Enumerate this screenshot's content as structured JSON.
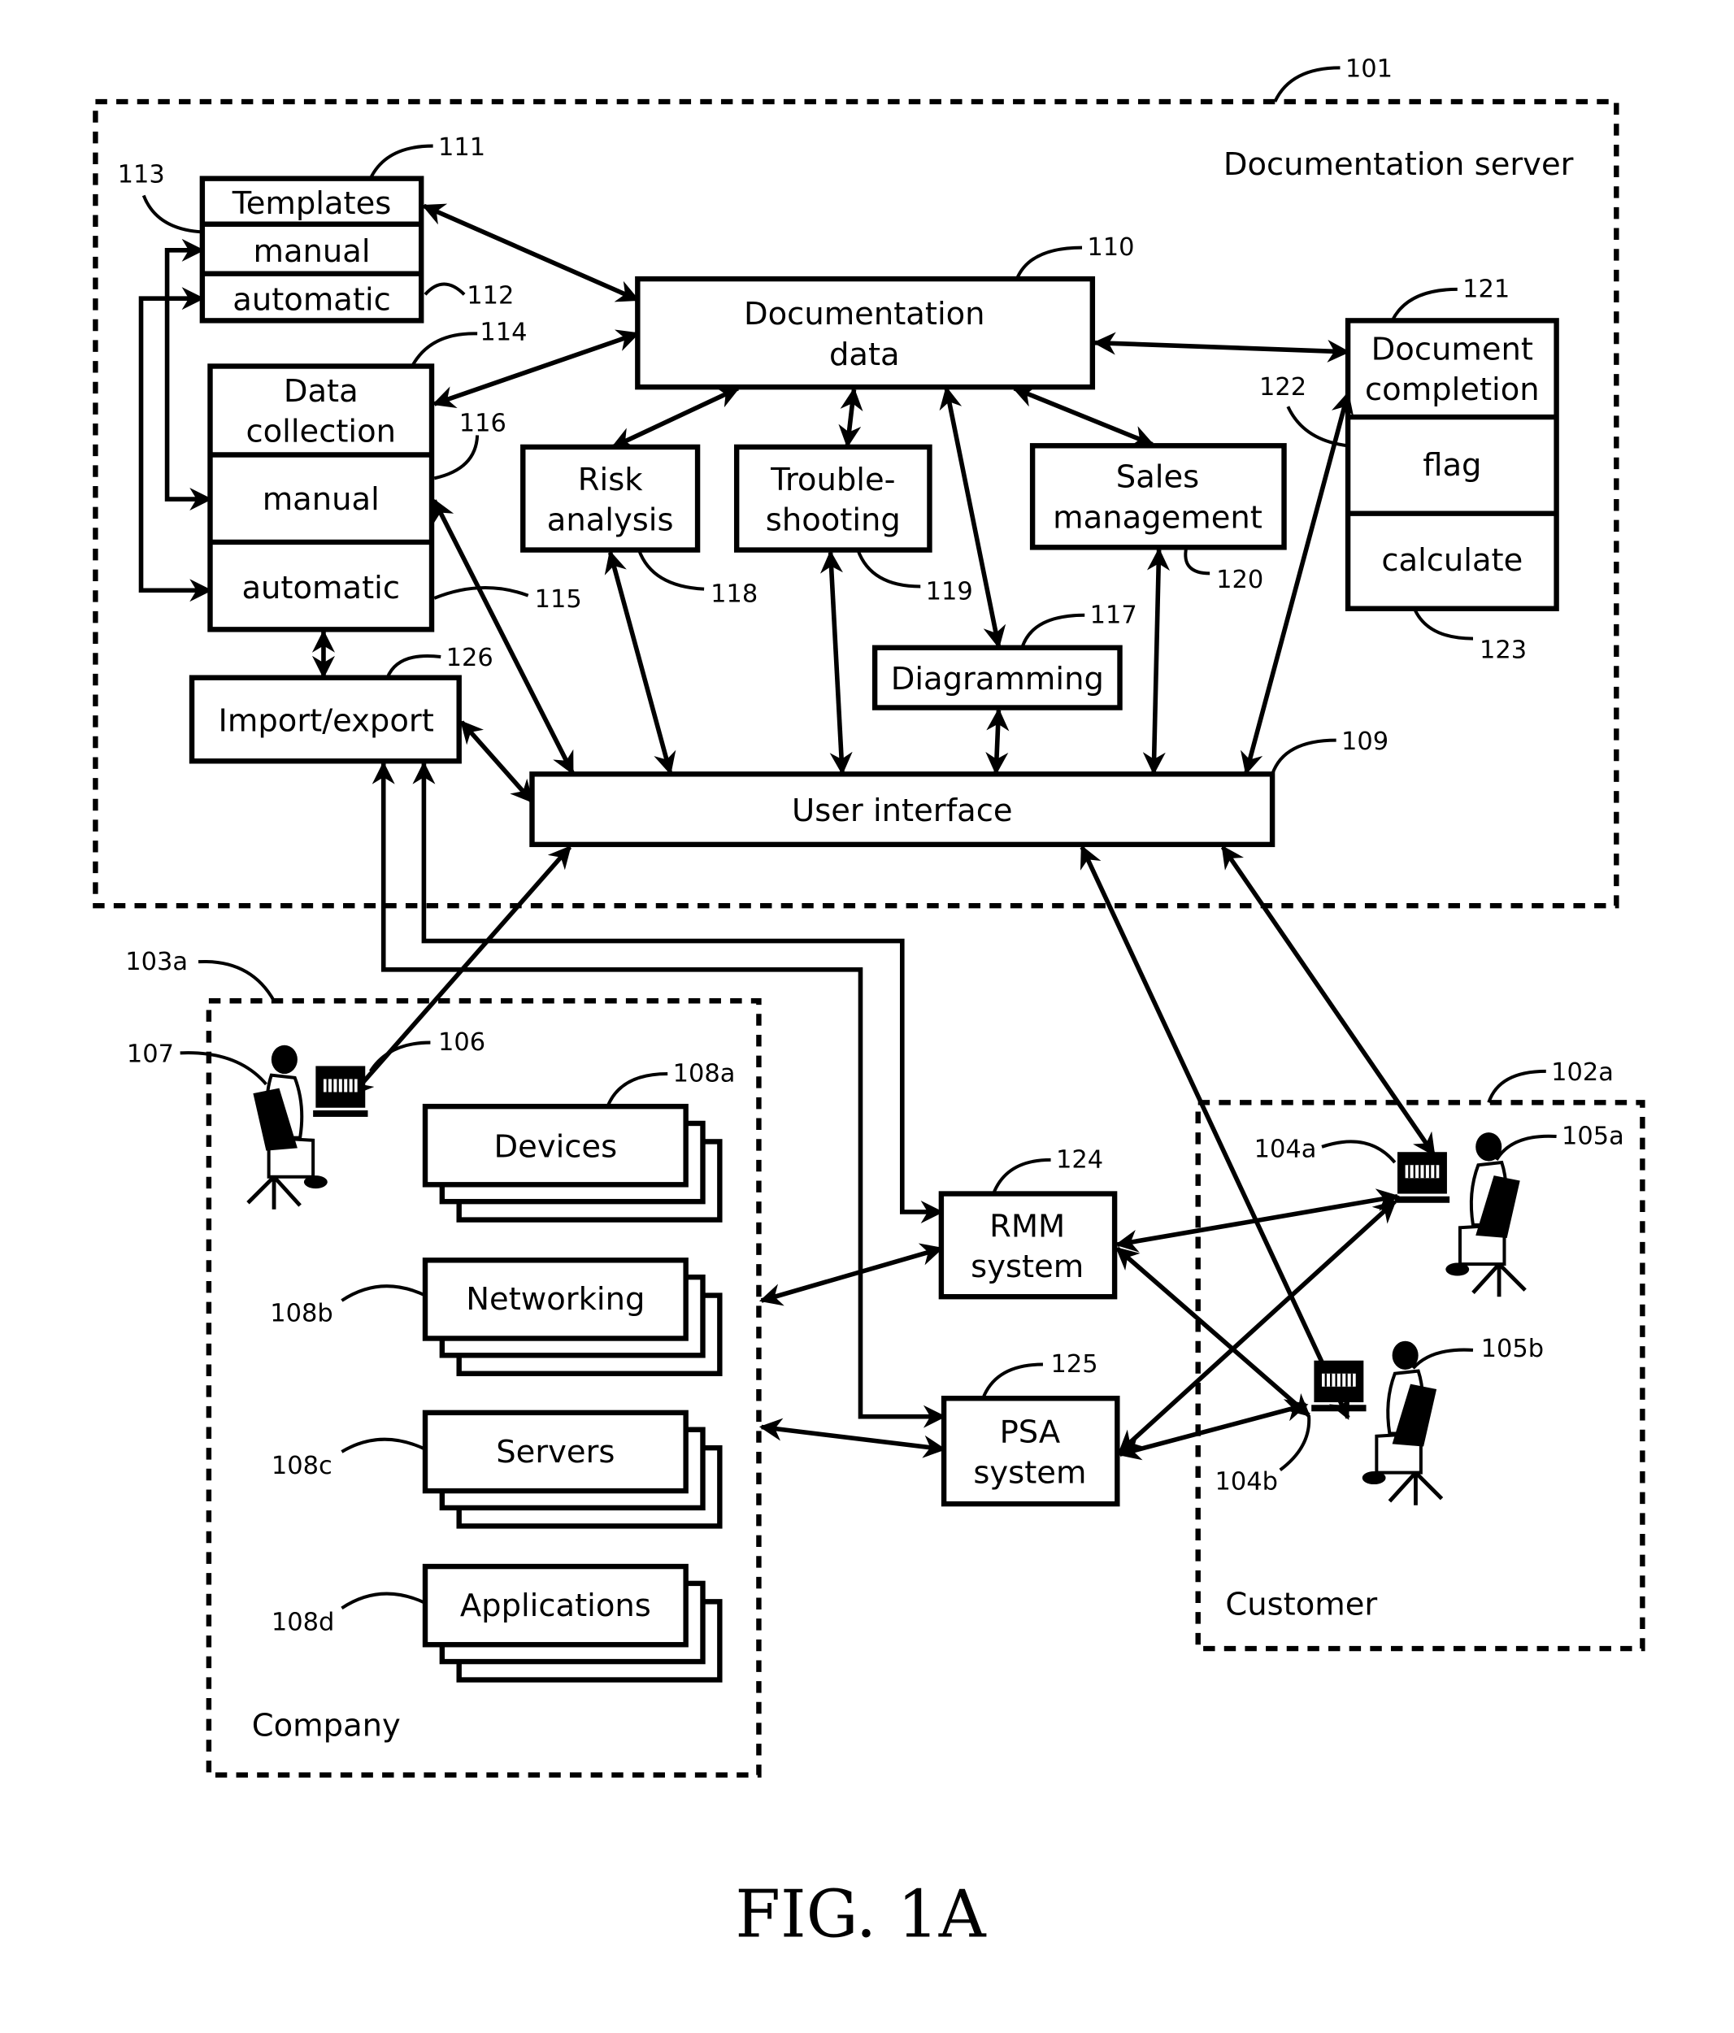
{
  "figure": {
    "caption": "FIG. 1A"
  },
  "server": {
    "label": "Documentation server",
    "ref": "101"
  },
  "templates": {
    "title": "Templates",
    "manual": "manual",
    "automatic": "automatic",
    "ref": "111",
    "ref_auto": "112",
    "ref_manual": "113"
  },
  "data_collection": {
    "title1": "Data",
    "title2": "collection",
    "manual": "manual",
    "automatic": "automatic",
    "ref": "114",
    "ref_auto": "115",
    "ref_manual": "116"
  },
  "doc_data": {
    "line1": "Documentation",
    "line2": "data",
    "ref": "110"
  },
  "risk": {
    "line1": "Risk",
    "line2": "analysis",
    "ref": "118"
  },
  "trouble": {
    "line1": "Trouble-",
    "line2": "shooting",
    "ref": "119"
  },
  "sales": {
    "line1": "Sales",
    "line2": "management",
    "ref": "120"
  },
  "doc_completion": {
    "line1": "Document",
    "line2": "completion",
    "flag": "flag",
    "calculate": "calculate",
    "ref": "121",
    "ref_flag": "122",
    "ref_calc": "123"
  },
  "diagramming": {
    "label": "Diagramming",
    "ref": "117"
  },
  "import_export": {
    "label": "Import/export",
    "ref": "126"
  },
  "user_interface": {
    "label": "User interface",
    "ref": "109"
  },
  "company": {
    "label": "Company",
    "ref": "103a",
    "user_ref": "107",
    "computer_ref": "106",
    "stacks": [
      {
        "label": "Devices",
        "ref": "108a"
      },
      {
        "label": "Networking",
        "ref": "108b"
      },
      {
        "label": "Servers",
        "ref": "108c"
      },
      {
        "label": "Applications",
        "ref": "108d"
      }
    ]
  },
  "rmm": {
    "line1": "RMM",
    "line2": "system",
    "ref": "124"
  },
  "psa": {
    "line1": "PSA",
    "line2": "system",
    "ref": "125"
  },
  "customer": {
    "label": "Customer",
    "ref": "102a",
    "computer_a": "104a",
    "user_a": "105a",
    "computer_b": "104b",
    "user_b": "105b"
  }
}
